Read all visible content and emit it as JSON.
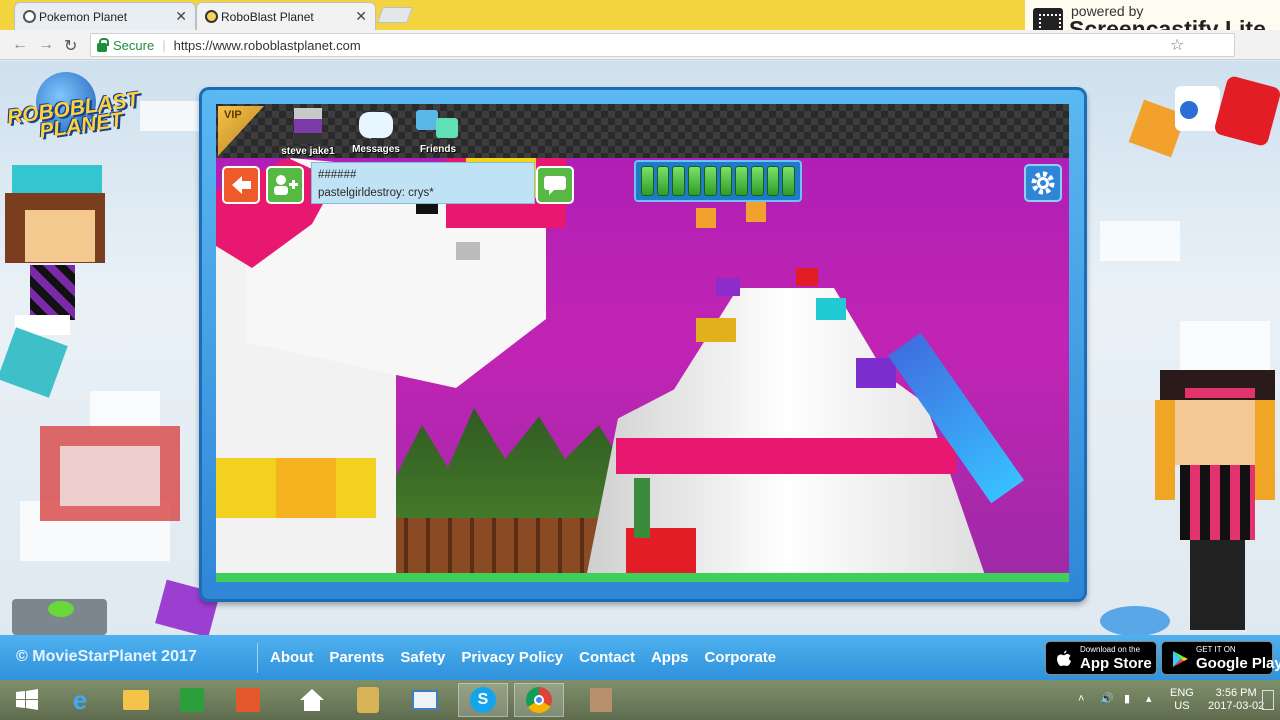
{
  "browser": {
    "tabs": [
      {
        "title": "Pokemon Planet",
        "active": false
      },
      {
        "title": "RoboBlast Planet",
        "active": true
      }
    ],
    "nav": {
      "back": "←",
      "forward": "→",
      "reload": "↻"
    },
    "secure_label": "Secure",
    "url": "https://www.roboblastplanet.com",
    "star": "☆"
  },
  "screencastify": {
    "line1": "powered by",
    "line2": "Screencastify Lite"
  },
  "site": {
    "logo_line1": "ROBOBLAST",
    "logo_line2": "PLANET"
  },
  "game": {
    "vip": "VIP",
    "topbar": {
      "profile_name": "steve jake1",
      "messages_label": "Messages",
      "friends_label": "Friends"
    },
    "chat": {
      "line1": "######",
      "line2": "pastelgirldestroy: crys*"
    },
    "energy_pips": 10,
    "icons": {
      "back": "back-arrow-icon",
      "add_friend": "add-friend-icon",
      "chat": "chat-bubble-icon",
      "settings": "gear-icon"
    }
  },
  "footer": {
    "copyright": "© MovieStarPlanet 2017",
    "links": [
      "About",
      "Parents",
      "Safety",
      "Privacy Policy",
      "Contact",
      "Apps",
      "Corporate"
    ],
    "app_store": {
      "small": "Download on the",
      "big": "App Store"
    },
    "google_play": {
      "small": "GET IT ON",
      "big": "Google Play"
    }
  },
  "taskbar": {
    "lang_line1": "ENG",
    "lang_line2": "US",
    "time": "3:56 PM",
    "date": "2017-03-02"
  },
  "colors": {
    "accent": "#2f92dc",
    "scene_bg": "#c124b4",
    "energy": "#2e9c2a",
    "tab_strip": "#f3d43f"
  }
}
